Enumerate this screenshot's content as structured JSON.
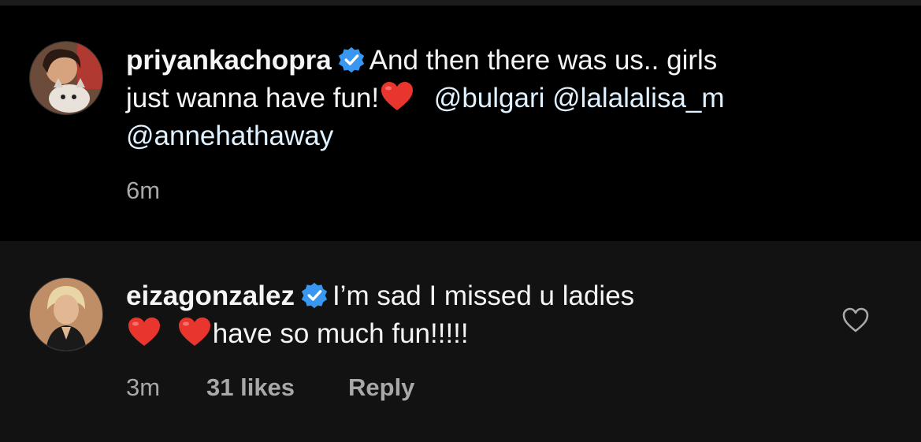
{
  "caption": {
    "username": "priyankachopra",
    "text_line1": "And then there was us.. girls",
    "text_line2_a": "just wanna have fun!",
    "mention_bulgari": "@bulgari",
    "mention_lisa": "@lalalalisa_m",
    "mention_anne": "@annehathaway",
    "time": "6m"
  },
  "reply": {
    "username": "eizagonzalez",
    "text_line1": "I’m sad I missed u ladies",
    "text_line2": "have so much fun!!!!!",
    "time": "3m",
    "likes": "31 likes",
    "reply_label": "Reply"
  },
  "icons": {
    "verified": "verified-badge-icon",
    "heart_emoji": "red-heart-emoji",
    "like": "heart-outline-icon"
  },
  "colors": {
    "background": "#000000",
    "reply_background": "#121212",
    "verified_blue": "#3897f0",
    "mention": "#e0f1ff",
    "meta": "#a8a8a8"
  }
}
